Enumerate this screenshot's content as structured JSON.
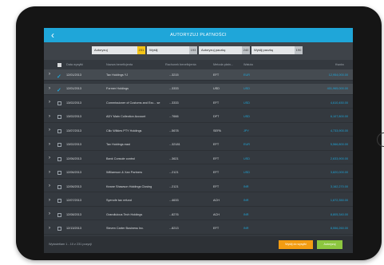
{
  "app": {
    "title": "AUTORYZUJ PŁATNOŚCI",
    "back_icon": "chevron-left-icon"
  },
  "filters": [
    {
      "label": "Autoryzuj",
      "count": "231",
      "active": true
    },
    {
      "label": "Wyślij",
      "count": "193",
      "active": false
    },
    {
      "label": "Autoryzuj paczkę",
      "count": "240",
      "active": false
    },
    {
      "label": "Wyślij paczkę",
      "count": "190",
      "active": false
    }
  ],
  "table": {
    "headers": {
      "date": "Data wysyłki",
      "beneficiary": "Nazwa beneficjenta",
      "account": "Rachunek beneficjenta",
      "method": "Metoda płatn...",
      "currency": "Waluta",
      "amount": "Kwota"
    },
    "rows": [
      {
        "date": "12/01/2013",
        "beneficiary": "Tax Holdings YJ",
        "account": "...3215",
        "method": "EFT",
        "currency": "EUR",
        "amount": "12,954,000.00",
        "checked": true
      },
      {
        "date": "12/01/2013",
        "beneficiary": "Former Holdings",
        "account": "...3333",
        "method": "USD",
        "currency": "USD",
        "amount": "401,965,000.00",
        "checked": true
      },
      {
        "date": "13/02/2013",
        "beneficiary": "Commissioner of Customs and Exc... se",
        "account": "...3333",
        "method": "EFT",
        "currency": "USD",
        "amount": "4,610,450.00",
        "checked": false
      },
      {
        "date": "13/02/2013",
        "beneficiary": "ADY Main Collection Account",
        "account": "...7666",
        "method": "DFT",
        "currency": "USD",
        "amount": "6,107,800.00",
        "checked": false
      },
      {
        "date": "13/07/2013",
        "beneficiary": "Cilic Wilkies PTY Holdings",
        "account": "...5678",
        "method": "SEPA",
        "currency": "JPY",
        "amount": "4,733,900.00",
        "checked": false
      },
      {
        "date": "13/02/2013",
        "beneficiary": "Tax Holdings east",
        "account": "...32181",
        "method": "EFT",
        "currency": "EUR",
        "amount": "5,566,800.00",
        "checked": false
      },
      {
        "date": "12/06/2013",
        "beneficiary": "Bank Console control",
        "account": "...3621",
        "method": "EFT",
        "currency": "USD",
        "amount": "2,633,900.00",
        "checked": false
      },
      {
        "date": "12/06/2013",
        "beneficiary": "Williamson & Xan Partners",
        "account": "...2121",
        "method": "EFT",
        "currency": "USD",
        "amount": "3,820,000.00",
        "checked": false
      },
      {
        "date": "12/06/2013",
        "beneficiary": "Keane Shawson Holdings Closing",
        "account": "...2121",
        "method": "EFT",
        "currency": "INR",
        "amount": "3,162,270.00",
        "checked": false
      },
      {
        "date": "12/07/2013",
        "beneficiary": "Syenofe tax refund",
        "account": "...4633",
        "method": "ACH",
        "currency": "INR",
        "amount": "1,672,350.00",
        "checked": false
      },
      {
        "date": "12/08/2013",
        "beneficiary": "Grandiulous Tech Holdings",
        "account": "...8276",
        "method": "ACH",
        "currency": "INR",
        "amount": "8,805,340.00",
        "checked": false
      },
      {
        "date": "12/13/2013",
        "beneficiary": "Steven Carter Business Inc.",
        "account": "...8213",
        "method": "EFT",
        "currency": "INR",
        "amount": "8,556,260.00",
        "checked": false
      }
    ]
  },
  "footer": {
    "status": "Wyświetlam 1 - 10 z 231 pozycji",
    "send_button": "Wyślij do wysyłki",
    "authorize_button": "Autoryzuj"
  },
  "colors": {
    "accent": "#1fa6d9",
    "orange": "#f39c12",
    "green": "#8cc63f",
    "badge": "#f5c518"
  }
}
